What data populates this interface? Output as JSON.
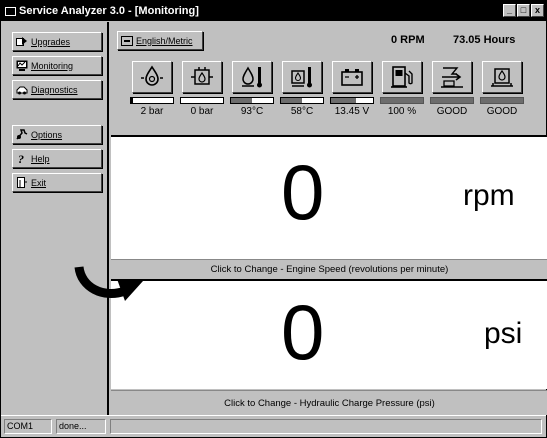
{
  "window": {
    "title": "Service Analyzer 3.0 - [Monitoring]",
    "controls": [
      "_",
      "□",
      "x"
    ]
  },
  "sidebar": {
    "items": [
      {
        "label": "Upgrades",
        "icon": "upgrades-icon"
      },
      {
        "label": "Monitoring",
        "icon": "monitoring-icon"
      },
      {
        "label": "Diagnostics",
        "icon": "diagnostics-icon"
      },
      {
        "label": "Options",
        "icon": "options-icon"
      },
      {
        "label": "Help",
        "icon": "help-icon"
      },
      {
        "label": "Exit",
        "icon": "exit-icon"
      }
    ]
  },
  "toolbar": {
    "units_label": "English/Metric",
    "rpm_readout": "0 RPM",
    "hours_readout": "73.05 Hours"
  },
  "gauges": [
    {
      "name": "engine-oil-pressure",
      "icon": "oil-pressure-icon",
      "value": "2 bar",
      "level": 0.05,
      "style": "white"
    },
    {
      "name": "hydraulic-charge-pressure",
      "icon": "hydraulic-pressure-icon",
      "value": "0 bar",
      "level": 0.0,
      "style": "white"
    },
    {
      "name": "oil-temperature",
      "icon": "oil-temperature-icon",
      "value": "93°C",
      "level": 0.5,
      "style": "split"
    },
    {
      "name": "hydraulic-temperature",
      "icon": "hydraulic-temperature-icon",
      "value": "58°C",
      "level": 0.5,
      "style": "split"
    },
    {
      "name": "battery-voltage",
      "icon": "battery-icon",
      "value": "13.45 V",
      "level": 0.6,
      "style": "split"
    },
    {
      "name": "fuel-level",
      "icon": "fuel-icon",
      "value": "100 %",
      "level": 1.0,
      "style": "dark"
    },
    {
      "name": "air-filter",
      "icon": "air-filter-icon",
      "value": "GOOD",
      "level": 1.0,
      "style": "dark"
    },
    {
      "name": "hydraulic-filter",
      "icon": "hydraulic-filter-icon",
      "value": "GOOD",
      "level": 1.0,
      "style": "dark"
    }
  ],
  "displays": [
    {
      "value": "0",
      "unit": "rpm",
      "caption": "Click to Change - Engine Speed (revolutions per minute)"
    },
    {
      "value": "0",
      "unit": "psi",
      "caption": "Click to Change - Hydraulic Charge Pressure (psi)"
    }
  ],
  "statusbar": {
    "port": "COM1",
    "status": "done...",
    "message": ""
  },
  "colors": {
    "face": "#c0c0c0",
    "titlebar": "#000000",
    "display_bg": "#ffffff"
  }
}
